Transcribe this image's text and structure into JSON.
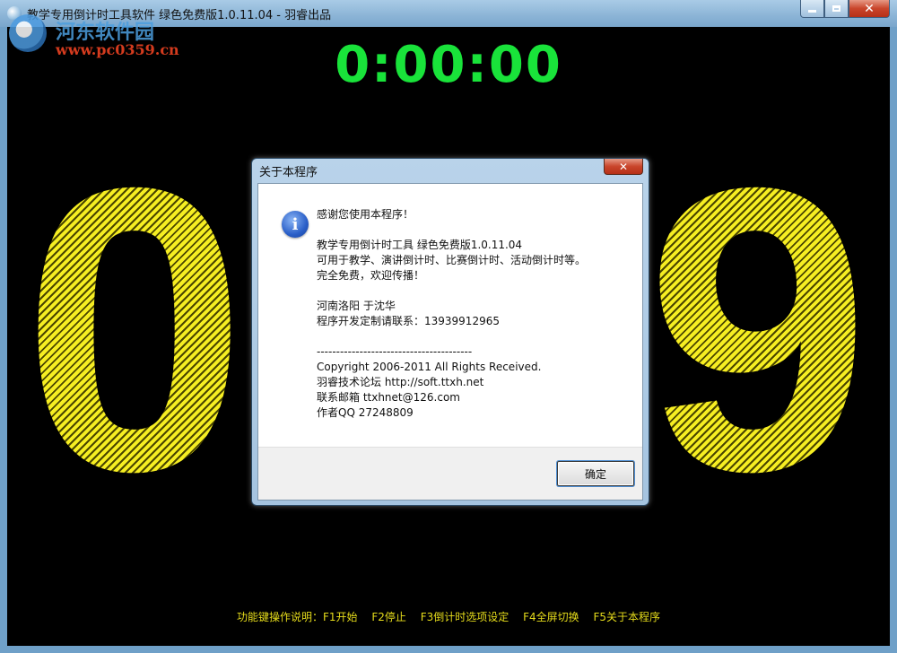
{
  "window": {
    "title": "教学专用倒计时工具软件 绿色免费版1.0.11.04 - 羽睿出品",
    "watermark_name": "河东软件园",
    "watermark_url": "www.pc0359.cn"
  },
  "clock": "0:00:00",
  "digits": {
    "left": "0",
    "right": "9",
    "color": "#ece31c"
  },
  "dialog": {
    "title": "关于本程序",
    "lines": [
      "感谢您使用本程序！",
      "",
      "教学专用倒计时工具 绿色免费版1.0.11.04",
      "可用于教学、演讲倒计时、比赛倒计时、活动倒计时等。",
      "完全免费，欢迎传播！",
      "",
      "河南洛阳 于沈华",
      "程序开发定制请联系：13939912965",
      "",
      "----------------------------------------",
      "Copyright 2006-2011 All Rights Received.",
      "羽睿技术论坛 http://soft.ttxh.net",
      "联系邮箱 ttxhnet@126.com",
      "作者QQ 27248809"
    ],
    "ok_label": "确定"
  },
  "help": {
    "label": "功能键操作说明：F1开始",
    "f2": "F2停止",
    "f3": "F3倒计时选项设定",
    "f4": "F4全屏切换",
    "f5": "F5关于本程序"
  },
  "colors": {
    "clock": "#19e33a",
    "help": "#e6dc1b",
    "background": "#000000"
  }
}
